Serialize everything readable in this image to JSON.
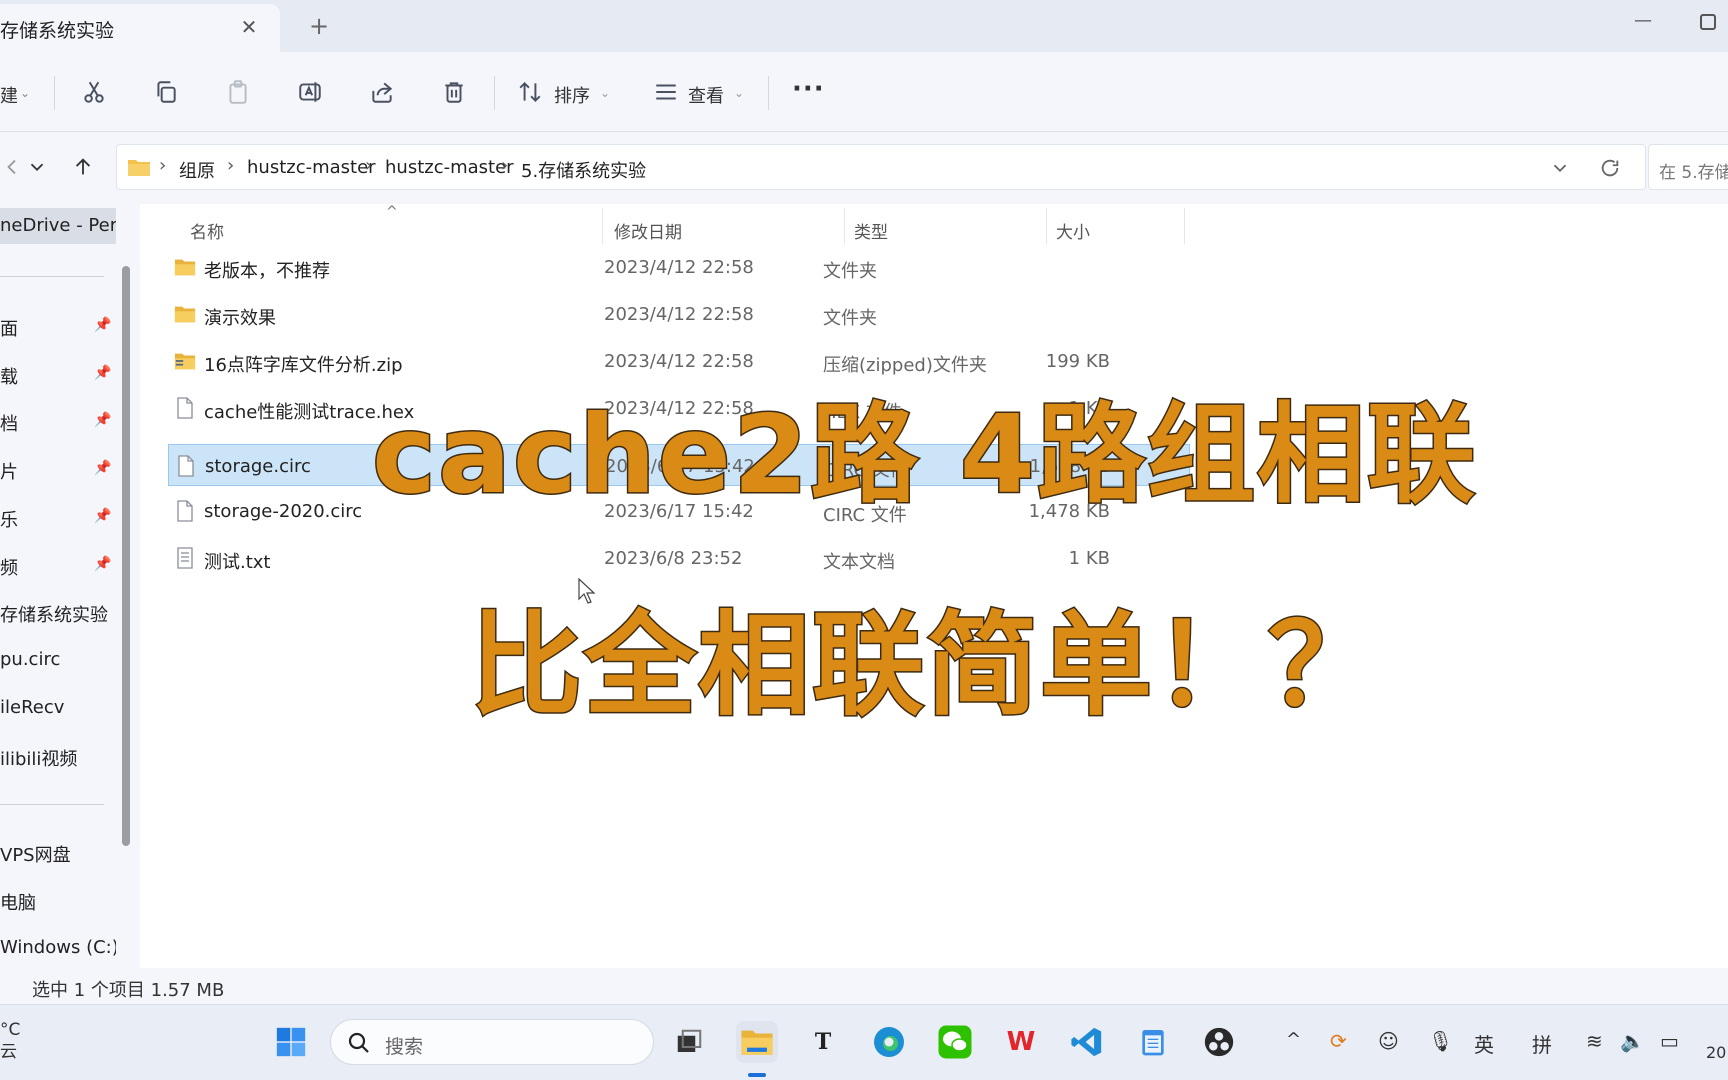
{
  "window": {
    "tab_title": "存储系统实验",
    "tab_close": "✕",
    "new_tab": "+",
    "minimize": "—"
  },
  "toolbar": {
    "new_label": "建",
    "sort_label": "排序",
    "view_label": "查看",
    "more": "···"
  },
  "address": {
    "crumbs": [
      "组原",
      "hustzc-master",
      "hustzc-master",
      "5.存储系统实验"
    ],
    "separator": "›",
    "search_placeholder": "在 5.存储"
  },
  "sidebar": {
    "items": [
      {
        "label": "neDrive - Per",
        "pinned": false,
        "selected": true
      },
      {
        "label": "面",
        "pinned": true
      },
      {
        "label": "载",
        "pinned": true
      },
      {
        "label": "档",
        "pinned": true
      },
      {
        "label": "片",
        "pinned": true
      },
      {
        "label": "乐",
        "pinned": true
      },
      {
        "label": "频",
        "pinned": true
      },
      {
        "label": "存储系统实验",
        "pinned": false
      },
      {
        "label": "pu.circ",
        "pinned": false
      },
      {
        "label": "ileRecv",
        "pinned": false
      },
      {
        "label": "ilibili视频",
        "pinned": false
      },
      {
        "label": "VPS网盘",
        "pinned": false
      },
      {
        "label": "电脑",
        "pinned": false
      },
      {
        "label": "Windows (C:)",
        "pinned": false
      }
    ]
  },
  "columns": {
    "name": "名称",
    "date": "修改日期",
    "type": "类型",
    "size": "大小"
  },
  "files": [
    {
      "name": "老版本，不推荐",
      "date": "2023/4/12 22:58",
      "type": "文件夹",
      "size": "",
      "icon": "folder-icon"
    },
    {
      "name": "演示效果",
      "date": "2023/4/12 22:58",
      "type": "文件夹",
      "size": "",
      "icon": "folder-icon"
    },
    {
      "name": "16点阵字库文件分析.zip",
      "date": "2023/4/12 22:58",
      "type": "压缩(zipped)文件夹",
      "size": "199 KB",
      "icon": "zip-folder-icon"
    },
    {
      "name": "cache性能测试trace.hex",
      "date": "2023/4/12 22:58",
      "type": "HEX 文件",
      "size": "1 KB",
      "icon": "file-icon"
    },
    {
      "name": "storage.circ",
      "date": "2023/6/17 15:42",
      "type": "CIRC 文件",
      "size": "1,608 KB",
      "icon": "file-icon",
      "selected": true
    },
    {
      "name": "storage-2020.circ",
      "date": "2023/6/17 15:42",
      "type": "CIRC 文件",
      "size": "1,478 KB",
      "icon": "file-icon"
    },
    {
      "name": "测试.txt",
      "date": "2023/6/8 23:52",
      "type": "文本文档",
      "size": "1 KB",
      "icon": "text-file-icon"
    }
  ],
  "status": {
    "text": "选中 1 个项目  1.57 MB"
  },
  "overlay": {
    "line1": "cache2路 4路组相联",
    "line2": "比全相联简单！？"
  },
  "taskbar": {
    "weather_temp": "°C",
    "weather_desc": "云",
    "search_label": "搜索",
    "tray_lang": "英",
    "tray_ime": "拼",
    "clock_partial": "20"
  },
  "colors": {
    "caption_fill": "#d98b16",
    "caption_stroke": "#3d2a10",
    "selection": "#cce4f7",
    "folder": "#f2c14e"
  }
}
